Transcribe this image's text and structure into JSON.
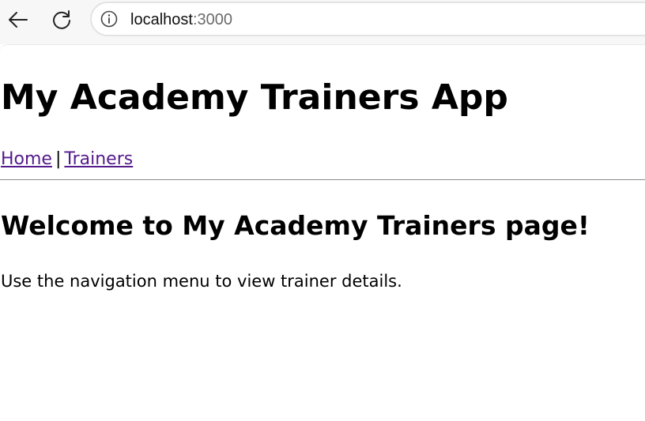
{
  "browser": {
    "url_host": "localhost",
    "url_port": ":3000",
    "icons": {
      "back": "back-arrow-icon",
      "reload": "reload-icon",
      "site_info": "info-icon"
    }
  },
  "page": {
    "title": "My Academy Trainers App",
    "nav": {
      "items": [
        {
          "label": "Home"
        },
        {
          "label": "Trainers"
        }
      ],
      "separator": "|"
    },
    "heading": "Welcome to My Academy Trainers page!",
    "body_text": "Use the navigation menu to view trainer details."
  },
  "colors": {
    "visited_link": "#551a8b",
    "text": "#000000",
    "url_port": "#6b6b6b"
  }
}
